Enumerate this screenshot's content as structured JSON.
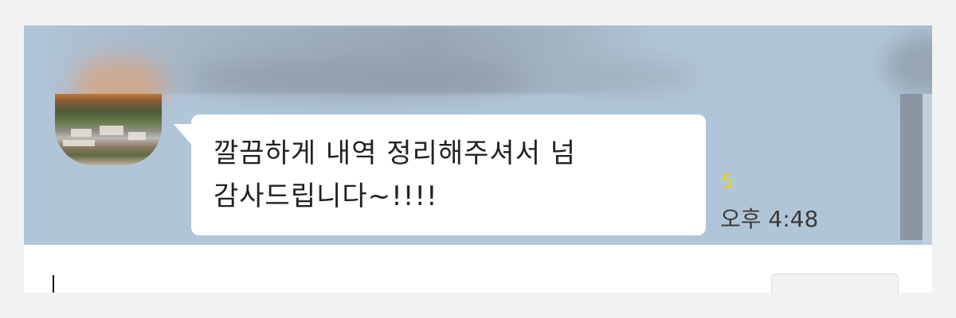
{
  "header": {
    "blurred": true
  },
  "message": {
    "sender_avatar": "profile-photo",
    "text": "깔끔하게 내역 정리해주셔서 넘 감사드립니다~!!!!",
    "unread_count": "5",
    "time": "오후 4:48"
  },
  "input": {
    "value": ""
  },
  "colors": {
    "chat_background": "#b1c5d9",
    "bubble": "#ffffff",
    "unread": "#f0d000"
  }
}
